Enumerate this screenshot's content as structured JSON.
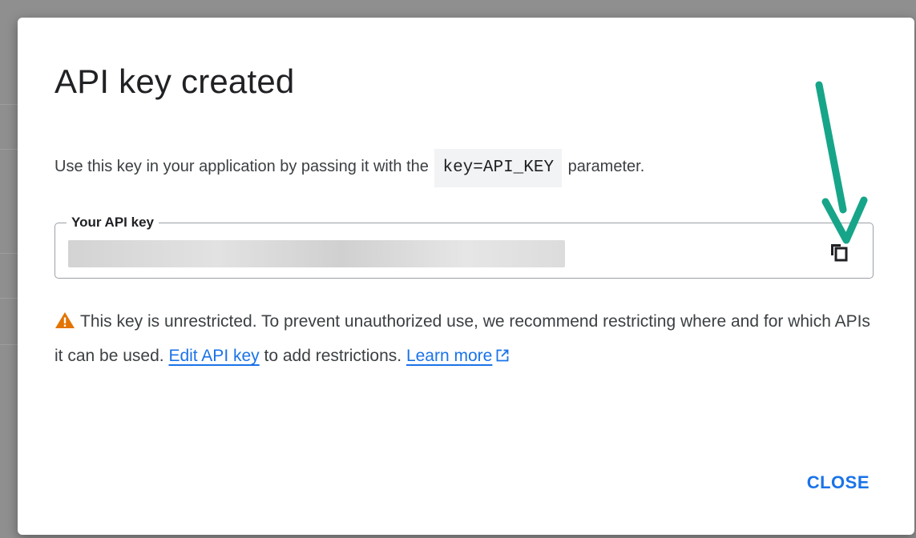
{
  "dialog": {
    "title": "API key created",
    "description_prefix": "Use this key in your application by passing it with the",
    "code_param": "key=API_KEY",
    "description_suffix": "parameter.",
    "key_field": {
      "label": "Your API key",
      "value_state": "redacted"
    },
    "copy_icon": "copy-icon",
    "warning": {
      "icon": "warning-icon",
      "text_before": "This key is unrestricted. To prevent unauthorized use, we recommend restricting where and for which APIs it can be used.",
      "edit_link": "Edit API key",
      "text_middle": "to add restrictions.",
      "learn_link": "Learn more",
      "external_icon": "external-link-icon"
    },
    "close_label": "CLOSE"
  },
  "colors": {
    "accent": "#1a73e8",
    "warning": "#e37400",
    "annotation_arrow": "#17a589"
  }
}
